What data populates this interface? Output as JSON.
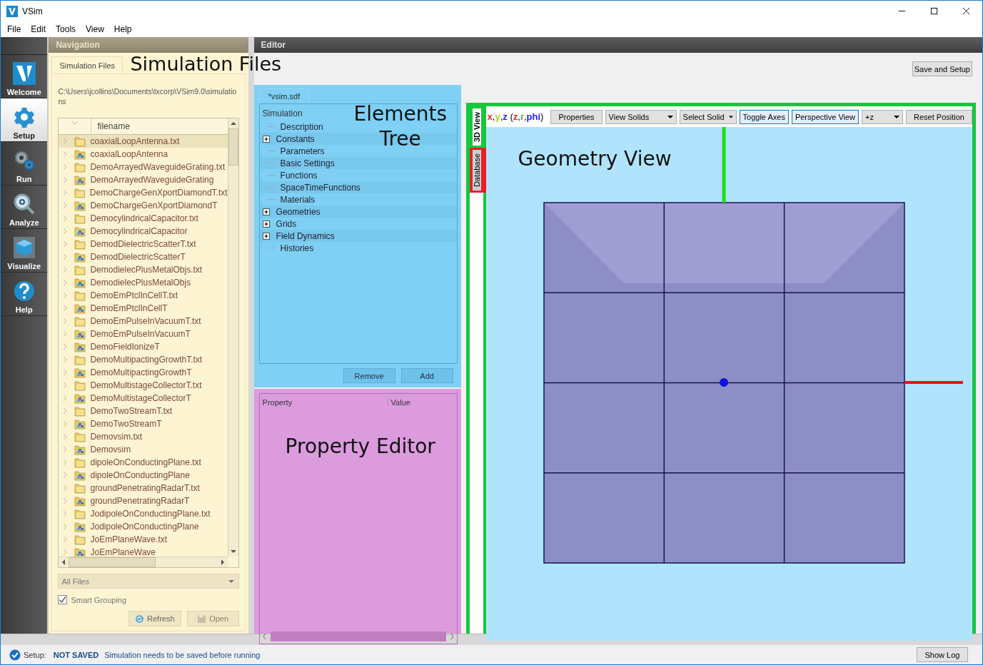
{
  "window": {
    "title": "VSim"
  },
  "menu": [
    "File",
    "Edit",
    "Tools",
    "View",
    "Help"
  ],
  "rail": [
    {
      "label": "Welcome",
      "selected": false
    },
    {
      "label": "Setup",
      "selected": true
    },
    {
      "label": "Run",
      "selected": false
    },
    {
      "label": "Analyze",
      "selected": false
    },
    {
      "label": "Visualize",
      "selected": false
    },
    {
      "label": "Help",
      "selected": false
    }
  ],
  "navigation": {
    "title": "Navigation",
    "tabs": [
      {
        "label": "Simulation Files",
        "selected": true
      }
    ],
    "annotation": "Simulation Files",
    "path": "C:\\Users\\jcollins\\Documents\\txcorp\\VSim9.0\\simulations",
    "column": "filename",
    "files": [
      {
        "name": "coaxialLoopAntenna.txt",
        "kind": "file",
        "selected": true
      },
      {
        "name": "coaxialLoopAntenna",
        "kind": "group",
        "selected": false
      },
      {
        "name": "DemoArrayedWaveguideGrating.txt",
        "kind": "file",
        "selected": false
      },
      {
        "name": "DemoArrayedWaveguideGrating",
        "kind": "group",
        "selected": false
      },
      {
        "name": "DemoChargeGenXportDiamondT.txt",
        "kind": "file",
        "selected": false
      },
      {
        "name": "DemoChargeGenXportDiamondT",
        "kind": "group",
        "selected": false
      },
      {
        "name": "DemocylindricalCapacitor.txt",
        "kind": "file",
        "selected": false
      },
      {
        "name": "DemocylindricalCapacitor",
        "kind": "group",
        "selected": false
      },
      {
        "name": "DemodDielectricScatterT.txt",
        "kind": "file",
        "selected": false
      },
      {
        "name": "DemodDielectricScatterT",
        "kind": "group",
        "selected": false
      },
      {
        "name": "DemodielecPlusMetalObjs.txt",
        "kind": "file",
        "selected": false
      },
      {
        "name": "DemodielecPlusMetalObjs",
        "kind": "group",
        "selected": false
      },
      {
        "name": "DemoEmPtclInCellT.txt",
        "kind": "file",
        "selected": false
      },
      {
        "name": "DemoEmPtclInCellT",
        "kind": "group",
        "selected": false
      },
      {
        "name": "DemoEmPulseInVacuumT.txt",
        "kind": "file",
        "selected": false
      },
      {
        "name": "DemoEmPulseInVacuumT",
        "kind": "group",
        "selected": false
      },
      {
        "name": "DemoFieldIonizeT",
        "kind": "group",
        "selected": false
      },
      {
        "name": "DemoMultipactingGrowthT.txt",
        "kind": "file",
        "selected": false
      },
      {
        "name": "DemoMultipactingGrowthT",
        "kind": "group",
        "selected": false
      },
      {
        "name": "DemoMultistageCollectorT.txt",
        "kind": "file",
        "selected": false
      },
      {
        "name": "DemoMultistageCollectorT",
        "kind": "group",
        "selected": false
      },
      {
        "name": "DemoTwoStreamT.txt",
        "kind": "file",
        "selected": false
      },
      {
        "name": "DemoTwoStreamT",
        "kind": "group",
        "selected": false
      },
      {
        "name": "Demovsim.txt",
        "kind": "file",
        "selected": false
      },
      {
        "name": "Demovsim",
        "kind": "group",
        "selected": false
      },
      {
        "name": "dipoleOnConductingPlane.txt",
        "kind": "file",
        "selected": false
      },
      {
        "name": "dipoleOnConductingPlane",
        "kind": "group",
        "selected": false
      },
      {
        "name": "groundPenetratingRadarT.txt",
        "kind": "file",
        "selected": false
      },
      {
        "name": "groundPenetratingRadarT",
        "kind": "group",
        "selected": false
      },
      {
        "name": "JodipoleOnConductingPlane.txt",
        "kind": "file",
        "selected": false
      },
      {
        "name": "JodipoleOnConductingPlane",
        "kind": "group",
        "selected": false
      },
      {
        "name": "JoEmPlaneWave.txt",
        "kind": "file",
        "selected": false
      },
      {
        "name": "JoEmPlaneWave",
        "kind": "group",
        "selected": false
      }
    ],
    "filter": "All Files",
    "smart_grouping": {
      "label": "Smart Grouping",
      "checked": true
    },
    "buttons": [
      {
        "label": "Refresh",
        "disabled": false
      },
      {
        "label": "Open",
        "disabled": true
      }
    ]
  },
  "editor": {
    "title": "Editor",
    "save_button": "Save and Setup",
    "tree": {
      "tab": "*vsim.sdf",
      "annotation": "Elements Tree",
      "root": "Simulation",
      "items": [
        {
          "label": "Description",
          "kind": "leaf"
        },
        {
          "label": "Constants",
          "kind": "group"
        },
        {
          "label": "Parameters",
          "kind": "leaf"
        },
        {
          "label": "Basic Settings",
          "kind": "leaf"
        },
        {
          "label": "Functions",
          "kind": "leaf"
        },
        {
          "label": "SpaceTimeFunctions",
          "kind": "leaf"
        },
        {
          "label": "Materials",
          "kind": "leaf"
        },
        {
          "label": "Geometries",
          "kind": "group"
        },
        {
          "label": "Grids",
          "kind": "group"
        },
        {
          "label": "Field Dynamics",
          "kind": "group"
        },
        {
          "label": "Histories",
          "kind": "leaf"
        }
      ],
      "buttons": [
        "Remove",
        "Add"
      ]
    },
    "property_editor": {
      "columns": [
        "Property",
        "Value"
      ],
      "annotation": "Property Editor"
    },
    "view_tabs": [
      {
        "label": "3D View",
        "selected": true,
        "color": "#14c83c"
      },
      {
        "label": "Database",
        "selected": false,
        "color": "#e8202a"
      }
    ],
    "coords": [
      {
        "text": "x",
        "color": "#ff2020",
        "after": ","
      },
      {
        "text": "y",
        "color": "#a0d020",
        "after": ","
      },
      {
        "text": "z",
        "color": "#2020ff",
        "after": " ("
      },
      {
        "text": "z",
        "color": "#ff2020",
        "after": ","
      },
      {
        "text": "r",
        "color": "#30c030",
        "after": ","
      },
      {
        "text": "phi",
        "color": "#2020ff",
        "after": ")"
      }
    ],
    "toolbar": [
      {
        "label": "Properties",
        "kind": "button"
      },
      {
        "label": "View Solids",
        "kind": "dropdown"
      },
      {
        "label": "Select Solid",
        "kind": "dropdown"
      },
      {
        "label": "Toggle Axes",
        "kind": "toggle",
        "checked": true
      },
      {
        "label": "Perspective View",
        "kind": "toggle",
        "checked": true
      },
      {
        "label": "+z",
        "kind": "dropdown"
      },
      {
        "label": "Reset Position",
        "kind": "button"
      }
    ],
    "view_annotation": "Geometry View"
  },
  "status_bar": {
    "mode": "Setup:",
    "state": "NOT SAVED",
    "message": "Simulation needs to be saved before running",
    "button": "Show Log"
  }
}
